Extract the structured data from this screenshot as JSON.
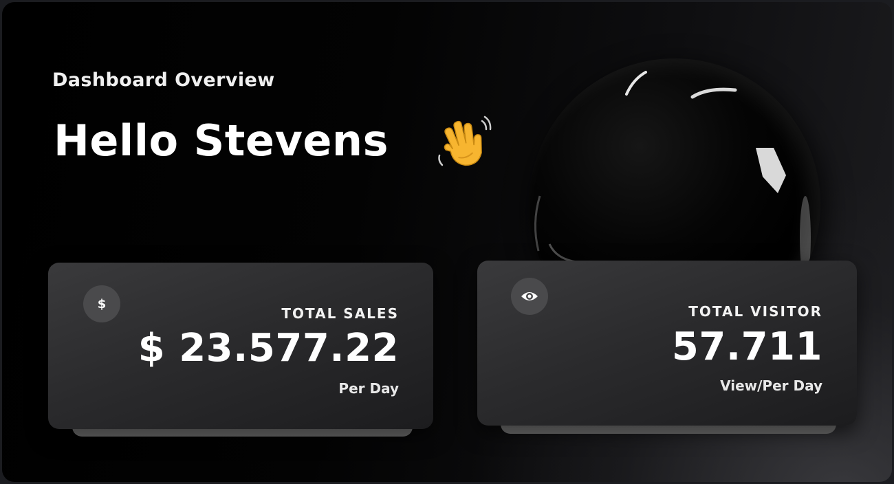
{
  "header": {
    "subtitle": "Dashboard Overview",
    "greeting": "Hello Stevens",
    "greeting_icon": "waving-hand-icon"
  },
  "stats": [
    {
      "icon": "dollar-icon",
      "icon_glyph": "$",
      "label": "TOTAL SALES",
      "value": "$ 23.577.22",
      "unit": "Per Day"
    },
    {
      "icon": "eye-icon",
      "label": "TOTAL VISITOR",
      "value": "57.711",
      "unit": "View/Per Day"
    }
  ],
  "colors": {
    "background": "#000000",
    "card": "#2b2b2d",
    "text": "#ffffff",
    "wave": "#f7b530"
  }
}
